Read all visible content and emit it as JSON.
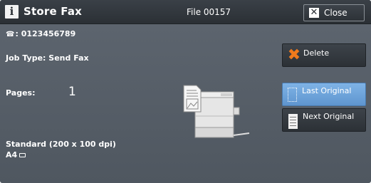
{
  "header": {
    "title": "Store Fax",
    "file_label": "File 00157",
    "close_label": "Close",
    "title_icon_glyph": "i"
  },
  "info": {
    "phone_icon": "☎",
    "phone": ": 0123456789",
    "job_type": "Job Type: Send Fax",
    "pages_label": "Pages:",
    "pages_value": "1",
    "resolution": "Standard (200 x 100 dpi)",
    "paper_size": "A4"
  },
  "buttons": {
    "delete_label": "Delete",
    "last_original_label": "Last Original",
    "next_original_label": "Next Original"
  },
  "icons": {
    "title": "info-icon",
    "phone": "phone-icon",
    "delete": "orange-x-icon",
    "last_original": "dotted-page-icon",
    "next_original": "page-icon",
    "machine": "multifunction-printer-icon",
    "paper_orientation": "landscape-paper-icon"
  },
  "colors": {
    "background": "#555d66",
    "titlebar": "#2b3035",
    "selected_button": "#6fa5dc",
    "delete_accent": "#f07a1c"
  }
}
